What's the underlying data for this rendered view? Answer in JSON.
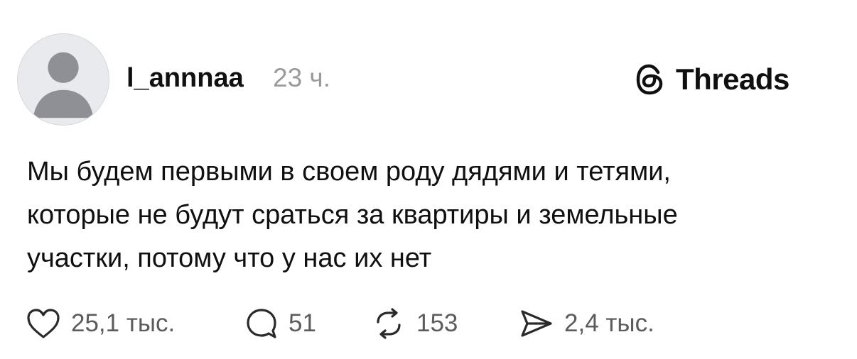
{
  "post": {
    "username": "l_annnaa",
    "timestamp": "23 ч.",
    "text_lines": [
      "Мы будем первыми в своем роду дядями и тетями,",
      "которые не будут сраться за квартиры и земельные",
      "участки, потому что у нас их нет"
    ]
  },
  "brand": {
    "name": "Threads",
    "icon": "threads-logo-icon"
  },
  "actions": {
    "like": {
      "icon": "heart-icon",
      "count": "25,1 тыс."
    },
    "reply": {
      "icon": "comment-icon",
      "count": "51"
    },
    "repost": {
      "icon": "repost-icon",
      "count": "153"
    },
    "share": {
      "icon": "send-icon",
      "count": "2,4 тыс."
    }
  },
  "colors": {
    "text": "#101010",
    "secondary": "#9a9a9a",
    "counts": "#5c5c5c",
    "avatar_bg": "#e9eaee",
    "avatar_figure": "#8e9096"
  }
}
